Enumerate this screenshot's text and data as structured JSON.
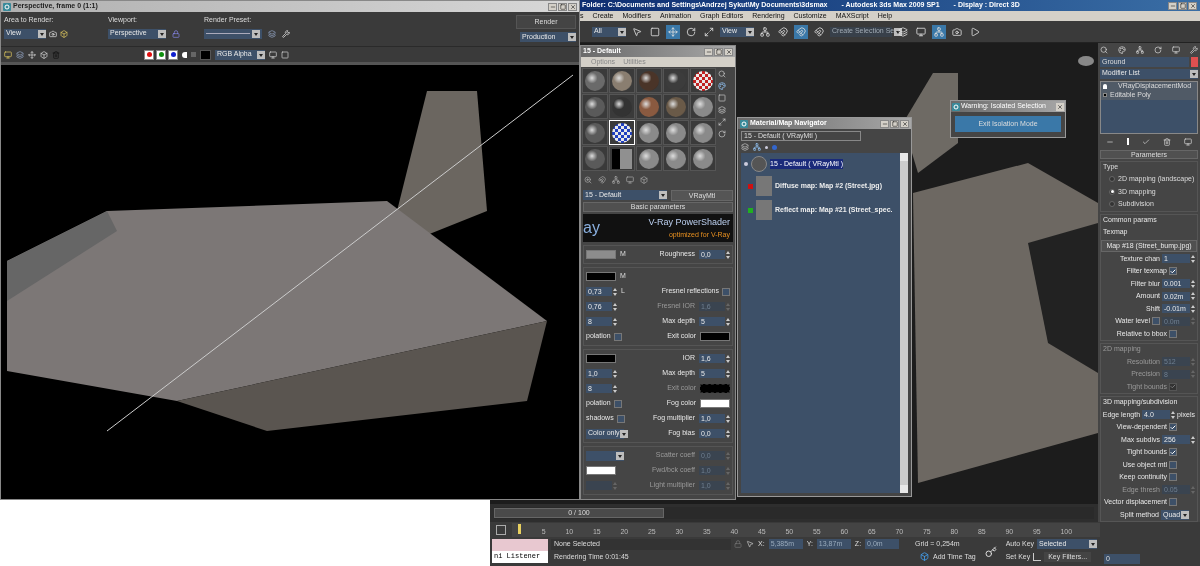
{
  "render_window": {
    "title": "Perspective, frame 0 (1:1)",
    "area_label": "Area to Render:",
    "area_value": "View",
    "viewport_label": "Viewport:",
    "viewport_value": "Perspective",
    "preset_label": "Render Preset:",
    "render_button": "Render",
    "preset_mode": "Production",
    "channel": "RGB Alpha",
    "channels": [
      {
        "color": "#e01010",
        "on": true
      },
      {
        "color": "#109010",
        "on": true
      },
      {
        "color": "#1020d0",
        "on": true
      }
    ]
  },
  "app": {
    "title_path": "Folder: C:\\Documents and Settings\\Andrzej Sykut\\My Documents\\3dsmax",
    "title_app": "- Autodesk 3ds Max  2009 SP1",
    "title_display": "- Display : Direct 3D",
    "menu": [
      "s",
      "Create",
      "Modifiers",
      "Animation",
      "Graph Editors",
      "Rendering",
      "Customize",
      "MAXScript",
      "Help"
    ],
    "selection_filter": "All",
    "ref_coord": "View",
    "selection_set_placeholder": "Create Selection Se"
  },
  "material_editor": {
    "title": "15 - Default",
    "menu": [
      "Options",
      "Utilities"
    ],
    "samples": [
      {
        "kind": "sphere",
        "color": "#6a6a6a",
        "selected": false
      },
      {
        "kind": "sphere",
        "color": "#8a7e70",
        "selected": false
      },
      {
        "kind": "sphere",
        "color": "#4a3428",
        "selected": false
      },
      {
        "kind": "sphere",
        "color": "#3c3c3c",
        "selected": false
      },
      {
        "kind": "checker",
        "color": "#c02020",
        "selected": false
      },
      {
        "kind": "sphere",
        "color": "#5a5a5a",
        "selected": false
      },
      {
        "kind": "sphere",
        "color": "#333333",
        "selected": false
      },
      {
        "kind": "sphere",
        "color": "#8a5a40",
        "selected": false
      },
      {
        "kind": "sphere",
        "color": "#6a5a48",
        "selected": false
      },
      {
        "kind": "sphere",
        "color": "#8a8a8a",
        "selected": false
      },
      {
        "kind": "sphere",
        "color": "#5a5a5a",
        "selected": false
      },
      {
        "kind": "checker",
        "color": "#2040c0",
        "selected": true
      },
      {
        "kind": "sphere",
        "color": "#8a8a8a",
        "selected": false
      },
      {
        "kind": "sphere",
        "color": "#8a8a8a",
        "selected": false
      },
      {
        "kind": "sphere",
        "color": "#8a8a8a",
        "selected": false
      },
      {
        "kind": "sphere",
        "color": "#5a5a5a",
        "selected": false
      },
      {
        "kind": "map",
        "color": "#909090",
        "selected": false
      },
      {
        "kind": "sphere",
        "color": "#8a8a8a",
        "selected": false
      },
      {
        "kind": "sphere",
        "color": "#8a8a8a",
        "selected": false
      },
      {
        "kind": "sphere",
        "color": "#8a8a8a",
        "selected": false
      }
    ],
    "material_name": "15 - Default",
    "material_type": "VRayMtl",
    "rollout": "Basic parameters",
    "banner_left": "ay",
    "banner_title": "V-Ray PowerShader",
    "banner_subtitle": "optimized for V-Ray",
    "sections": [
      [
        {
          "left": {
            "kind": "swatch",
            "color": "#8c8c8c",
            "suffix": "M",
            "disabled": false
          },
          "right": {
            "kind": "spinner",
            "label": "Roughness",
            "value": "0,0",
            "disabled": false
          }
        }
      ],
      [
        {
          "left": {
            "kind": "swatch",
            "color": "#000000",
            "suffix": "M",
            "disabled": false
          }
        },
        {
          "left": {
            "kind": "spinner",
            "value": "0,73",
            "suffix": "L",
            "disabled": false
          },
          "right": {
            "kind": "check",
            "label": "Fresnel reflections",
            "checked": false,
            "disabled": false
          }
        },
        {
          "left": {
            "kind": "spinner",
            "value": "0,76",
            "disabled": false
          },
          "right": {
            "kind": "spinner",
            "label": "Fresnel IOR",
            "value": "1,6",
            "disabled": true
          }
        },
        {
          "left": {
            "kind": "spinner",
            "value": "8",
            "disabled": false
          },
          "right": {
            "kind": "spinner",
            "label": "Max depth",
            "value": "5",
            "disabled": false
          }
        },
        {
          "left": {
            "kind": "check",
            "label": "polation",
            "checked": false,
            "disabled": false
          },
          "right": {
            "kind": "swatch",
            "label": "Exit color",
            "color": "#000000",
            "disabled": false
          }
        }
      ],
      [
        {
          "left": {
            "kind": "swatch",
            "color": "#000000",
            "disabled": false
          },
          "right": {
            "kind": "spinner",
            "label": "IOR",
            "value": "1,6",
            "disabled": false
          }
        },
        {
          "left": {
            "kind": "spinner",
            "value": "1,0",
            "disabled": false
          },
          "right": {
            "kind": "spinner",
            "label": "Max depth",
            "value": "5",
            "disabled": false
          }
        },
        {
          "left": {
            "kind": "spinner",
            "value": "8",
            "disabled": false
          },
          "right": {
            "kind": "swatch",
            "label": "Exit color",
            "color": "#000000",
            "disabled": true
          }
        },
        {
          "left": {
            "kind": "check",
            "label": "polation",
            "checked": false,
            "disabled": false
          },
          "right": {
            "kind": "swatch",
            "label": "Fog color",
            "color": "#ffffff",
            "disabled": false
          }
        },
        {
          "left": {
            "kind": "check",
            "label": "shadows",
            "checked": false,
            "disabled": false
          },
          "right": {
            "kind": "spinner",
            "label": "Fog multiplier",
            "value": "1,0",
            "disabled": false
          }
        },
        {
          "left": {
            "kind": "dropdown",
            "value": "Color only",
            "disabled": false
          },
          "right": {
            "kind": "spinner",
            "label": "Fog bias",
            "value": "0,0",
            "disabled": false
          }
        }
      ],
      [
        {
          "left": {
            "kind": "dropdown",
            "disabled": false
          },
          "right": {
            "kind": "spinner",
            "label": "Scatter coeff",
            "value": "0,0",
            "disabled": true
          }
        },
        {
          "left": {
            "kind": "swatch",
            "color": "#ffffff",
            "disabled": false
          },
          "right": {
            "kind": "spinner",
            "label": "Fwd/bck coeff",
            "value": "1,0",
            "disabled": true
          }
        },
        {
          "left": {
            "kind": "spinner",
            "disabled": true
          },
          "right": {
            "kind": "spinner",
            "label": "Light multiplier",
            "value": "1,0",
            "disabled": true
          }
        }
      ]
    ]
  },
  "navigator": {
    "title": "Material/Map Navigator",
    "field": "15 - Default  ( VRayMtl )",
    "tree": [
      {
        "label": "15 - Default  ( VRayMtl )",
        "selected": true,
        "children": [
          {
            "label": "Diffuse map: Map #2 (Street.jpg)",
            "color": "#d01010",
            "selected": false
          },
          {
            "label": "Reflect map: Map #21 (Street_spec.",
            "color": "#20b020",
            "selected": false
          }
        ]
      }
    ]
  },
  "warning": {
    "title": "Warning: Isolated Selection",
    "button": "Exit Isolation Mode"
  },
  "command_panel": {
    "object_name": "Ground",
    "modifier_list": "Modifier List",
    "stack": [
      {
        "label": "VRayDisplacementMod",
        "kind": "modifier"
      },
      {
        "label": "Editable Poly",
        "kind": "base"
      }
    ],
    "rollout": "Parameters",
    "type_label": "Type",
    "types": [
      {
        "label": "2D mapping (landscape)",
        "selected": false
      },
      {
        "label": "3D mapping",
        "selected": true
      },
      {
        "label": "Subdivision",
        "selected": false
      }
    ],
    "groups": [
      {
        "title": "Common params",
        "disabled": false,
        "rows": [
          {
            "kind": "label",
            "label": "Texmap",
            "disabled": false
          },
          {
            "kind": "button",
            "value": "Map #18 (Street_bump.jpg)",
            "disabled": false
          },
          {
            "kind": "spinner",
            "label": "Texture chan",
            "value": "1",
            "disabled": false
          },
          {
            "kind": "check",
            "label": "Filter texmap",
            "checked": true,
            "disabled": false
          },
          {
            "kind": "spinner",
            "label": "Filter blur",
            "value": "0.001",
            "disabled": false
          },
          {
            "kind": "spinner",
            "label": "Amount",
            "value": "0.02m",
            "disabled": false
          },
          {
            "kind": "spinner",
            "label": "Shift",
            "value": "-0.01m",
            "disabled": false
          },
          {
            "kind": "check_spinner",
            "label": "Water level",
            "checked": false,
            "value": "0.0m",
            "disabled": false
          },
          {
            "kind": "check",
            "label": "Relative to bbox",
            "checked": false,
            "disabled": false
          }
        ]
      },
      {
        "title": "2D mapping",
        "disabled": true,
        "rows": [
          {
            "kind": "spinner",
            "label": "Resolution",
            "value": "512",
            "disabled": true
          },
          {
            "kind": "spinner",
            "label": "Precision",
            "value": "8",
            "disabled": true
          },
          {
            "kind": "check",
            "label": "Tight bounds",
            "checked": true,
            "disabled": true
          }
        ]
      },
      {
        "title": "3D mapping/subdivision",
        "disabled": false,
        "rows": [
          {
            "kind": "spinner",
            "label": "Edge length",
            "value": "4.0",
            "suffix": "pixels",
            "disabled": false
          },
          {
            "kind": "check",
            "label": "View-dependent",
            "checked": true,
            "disabled": false
          },
          {
            "kind": "spinner",
            "label": "Max subdivs",
            "value": "256",
            "disabled": false
          },
          {
            "kind": "check",
            "label": "Tight bounds",
            "checked": true,
            "disabled": false
          },
          {
            "kind": "check",
            "label": "Use object mtl",
            "checked": false,
            "disabled": false
          },
          {
            "kind": "check",
            "label": "Keep continuity",
            "checked": false,
            "disabled": false
          },
          {
            "kind": "spinner",
            "label": "Edge thresh",
            "value": "0.05",
            "disabled": true
          },
          {
            "kind": "check",
            "label": "Vector displacement",
            "checked": false,
            "disabled": false
          },
          {
            "kind": "dropdown",
            "label": "Split method",
            "value": "Quad",
            "disabled": false
          }
        ]
      }
    ]
  },
  "timeline": {
    "position": "0 / 100",
    "level": 0,
    "ticks": [
      "5",
      "10",
      "15",
      "20",
      "25",
      "30",
      "35",
      "40",
      "45",
      "50",
      "55",
      "60",
      "65",
      "70",
      "75",
      "80",
      "85",
      "90",
      "95",
      "100"
    ]
  },
  "status": {
    "listener": "ni Listener",
    "selection": "None Selected",
    "render_time": "Rendering Time  0:01:45",
    "x_label": "X:",
    "x": "5,385m",
    "y_label": "Y:",
    "y": "13,87m",
    "z_label": "Z:",
    "z": "0,0m",
    "grid": "Grid = 0,254m",
    "time_tag": "Add Time Tag",
    "auto_key": "Auto Key",
    "key_mode": "Selected",
    "set_key": "Set Key",
    "key_filters": "Key Filters...",
    "frame": "0"
  }
}
